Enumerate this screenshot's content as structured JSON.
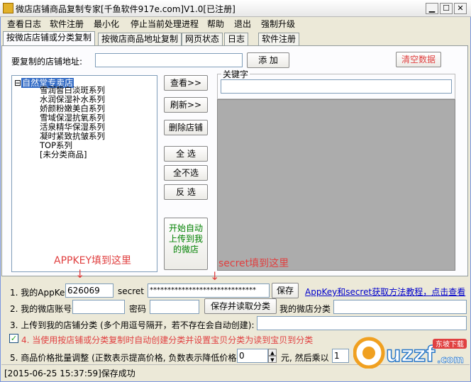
{
  "window": {
    "title": "微店店铺商品复制专家[千鱼软件917e.com]V1.0[已注册]",
    "min_glyph": "▁",
    "max_glyph": "☐",
    "close_glyph": "✕"
  },
  "menu": [
    "查看日志",
    "软件注册",
    "最小化",
    "停止当前处理进程",
    "帮助",
    "退出",
    "强制升级"
  ],
  "tabs": [
    "按微店店铺或分类复制",
    "按微店商品地址复制",
    "网页状态",
    "日志",
    "软件注册"
  ],
  "store_url": {
    "label": "要复制的店铺地址:",
    "value": "",
    "add_button": "添  加",
    "clear_button": "清空数据"
  },
  "tree": {
    "root_toggle": "⊟",
    "root_label": "自然堂专卖店",
    "children": [
      "雪润皙白淡斑系列",
      "水润保湿补水系列",
      "娇颜粉嫩美白系列",
      "雪域保湿抗氧系列",
      "活泉精华保湿系列",
      "凝时紧致抗皱系列",
      "TOP系列",
      "[未分类商品]"
    ]
  },
  "action_buttons": {
    "view": "查看>>",
    "refresh": "刷新>>",
    "delete_store": "删除店铺",
    "select_all": "全  选",
    "select_none": "全不选",
    "invert": "反  选",
    "start_upload": "开始自动上传到我的微店"
  },
  "keyword": {
    "label": "关键字",
    "value": ""
  },
  "annotations": {
    "appkey_hint": "APPKEY填到这里",
    "secret_hint": "secret填到这里",
    "arrow_glyph": "↓"
  },
  "form": {
    "appkey_label": "1. 我的AppKey",
    "appkey_value": "626069",
    "secret_label": "secret",
    "secret_value": "******************************",
    "save_button": "保存",
    "tutorial_link": "AppKey和secret获取方法教程，点击查看",
    "account_label": "2. 我的微店账号",
    "account_value": "",
    "password_label": "密码",
    "password_value": "",
    "save_read_button": "保存并读取分类",
    "my_category_label": "我的微店分类",
    "my_category_value": "",
    "upload_category_label": "3. 上传到我的店铺分类 (多个用逗号隔开，若不存在会自动创建):",
    "upload_category_value": "",
    "auto_create_check": "✓",
    "auto_create_label": "4. 当使用按店铺或分类复制时自动创建分类并设置宝贝分类为读到宝贝到分类",
    "price_label": "5. 商品价格批量调整 (正数表示提高价格, 负数表示降低价格)",
    "price_value": "0",
    "price_suffix": "元, 然后乘以",
    "multiplier_value": "1",
    "spin_up": "▲",
    "spin_down": "▼"
  },
  "status_bar": "[2015-06-25 15:37:59]保存成功",
  "watermark": {
    "brand": "uzzf",
    "domain_suffix": ".com",
    "tagline": "东坡下载"
  },
  "colors": {
    "accent_red": "#e04040",
    "link_blue": "#0000cc",
    "tree_select": "#316ac5",
    "upload_green": "#008000"
  }
}
